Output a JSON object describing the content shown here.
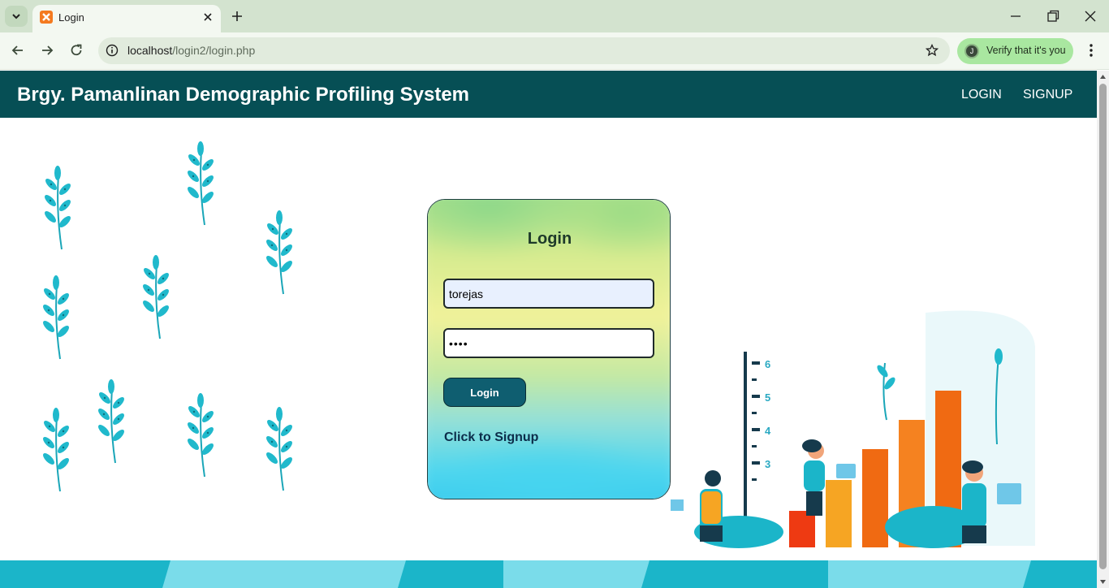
{
  "browser": {
    "tab_title": "Login",
    "url_host": "localhost",
    "url_path": "/login2/login.php",
    "verify_label": "Verify that it's you",
    "verify_avatar_initial": "J"
  },
  "navbar": {
    "title": "Brgy. Pamanlinan Demographic Profiling System",
    "links": [
      "LOGIN",
      "SIGNUP"
    ],
    "bg_color": "#064f55"
  },
  "login_form": {
    "title": "Login",
    "username_value": "torejas",
    "password_value": "••••",
    "submit_label": "Login",
    "signup_link": "Click to Signup",
    "button_color": "#0f5e70"
  },
  "illustration": {
    "axis_ticks": [
      "6",
      "5",
      "4",
      "3"
    ],
    "accent_colors": [
      "#f58220",
      "#e8420c",
      "#1bb5c9"
    ]
  }
}
